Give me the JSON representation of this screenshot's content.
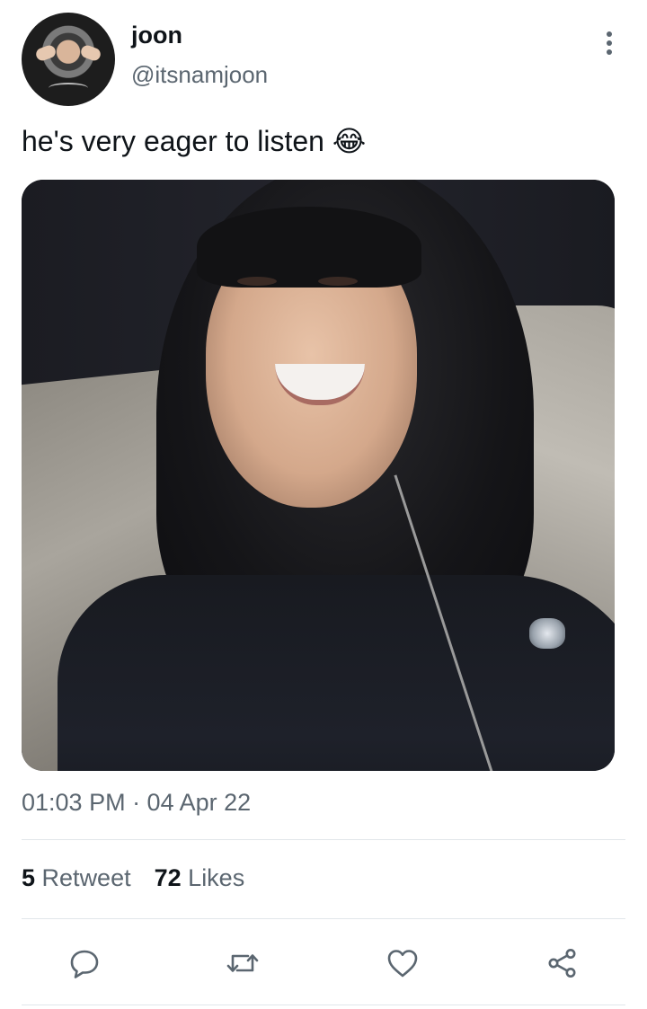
{
  "author": {
    "display_name": "joon",
    "handle": "@itsnamjoon"
  },
  "tweet": {
    "text": "he's very eager to listen 😂",
    "timestamp": "01:03 PM · 04 Apr 22"
  },
  "stats": {
    "retweets": "5",
    "retweets_label": "Retweet",
    "likes": "72",
    "likes_label": "Likes"
  },
  "icons": {
    "more": "more-vertical-icon",
    "reply": "reply-icon",
    "retweet": "retweet-icon",
    "like": "heart-icon",
    "share": "share-icon"
  },
  "colors": {
    "text_primary": "#0f1419",
    "text_secondary": "#5b6670",
    "divider": "#e1e6ea"
  }
}
